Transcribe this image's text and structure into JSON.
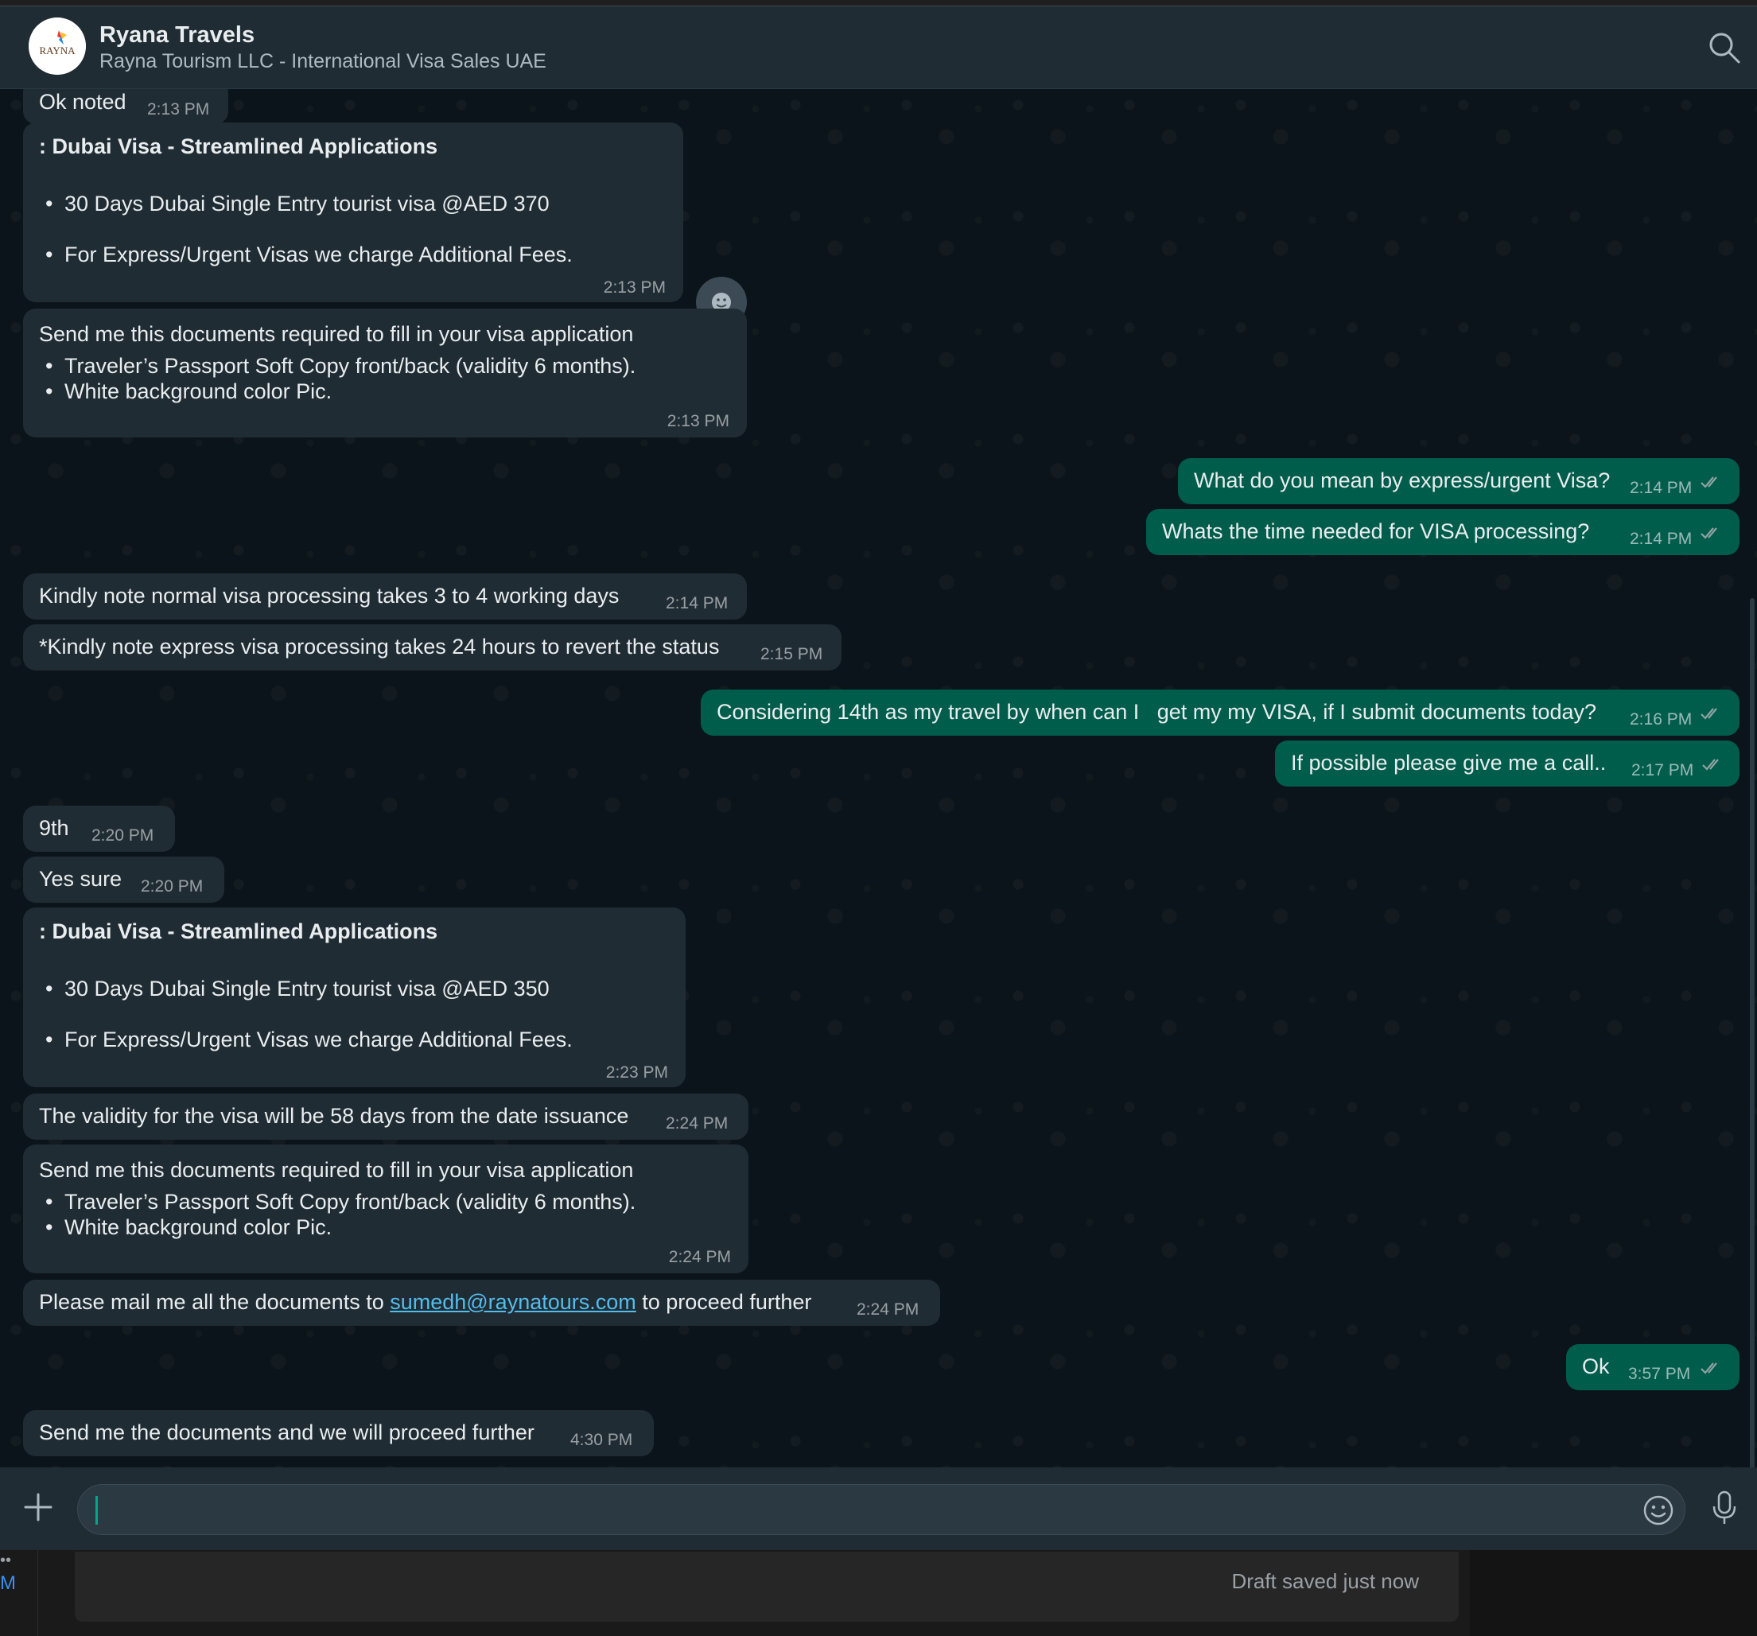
{
  "header": {
    "contact_name": "Ryana Travels",
    "contact_subtitle": "Rayna Tourism LLC - International Visa Sales UAE",
    "avatar_text": "RAYNA"
  },
  "messages": [
    {
      "id": "m0",
      "dir": "in",
      "text": "Ok noted",
      "time": "2:13 PM"
    },
    {
      "id": "m1",
      "dir": "in",
      "title": ": Dubai Visa - Streamlined Applications",
      "bullets": [
        "30 Days Dubai Single Entry tourist visa @AED 370",
        "For Express/Urgent Visas we charge Additional Fees."
      ],
      "time": "2:13 PM"
    },
    {
      "id": "m2",
      "dir": "in",
      "text": "Send me this documents required to fill in your visa application",
      "bullets": [
        "Traveler’s Passport Soft Copy front/back (validity 6 months).",
        "White background color Pic."
      ],
      "time": "2:13 PM"
    },
    {
      "id": "m3",
      "dir": "out",
      "text": "What do you mean by express/urgent Visa?",
      "time": "2:14 PM"
    },
    {
      "id": "m4",
      "dir": "out",
      "text": "Whats the time needed for VISA processing?",
      "time": "2:14 PM"
    },
    {
      "id": "m5",
      "dir": "in",
      "text": "Kindly note normal visa processing takes 3 to 4 working days",
      "time": "2:14 PM"
    },
    {
      "id": "m6",
      "dir": "in",
      "text": "*Kindly note express visa processing takes 24 hours to revert the status",
      "time": "2:15 PM"
    },
    {
      "id": "m7",
      "dir": "out",
      "text": "Considering 14th as my travel by when can I   get my my VISA, if I submit documents today?",
      "time": "2:16 PM"
    },
    {
      "id": "m8",
      "dir": "out",
      "text": "If possible please give me a call..",
      "time": "2:17 PM"
    },
    {
      "id": "m9",
      "dir": "in",
      "text": "9th",
      "time": "2:20 PM"
    },
    {
      "id": "m10",
      "dir": "in",
      "text": "Yes sure",
      "time": "2:20 PM"
    },
    {
      "id": "m11",
      "dir": "in",
      "title": ": Dubai Visa - Streamlined Applications",
      "bullets": [
        "30 Days Dubai Single Entry tourist visa @AED 350",
        "For Express/Urgent Visas we charge Additional Fees."
      ],
      "time": "2:23 PM"
    },
    {
      "id": "m12",
      "dir": "in",
      "text": "The validity for the visa will be 58 days from the date issuance",
      "time": "2:24 PM"
    },
    {
      "id": "m13",
      "dir": "in",
      "text": "Send me this documents required to fill in your visa application",
      "bullets": [
        "Traveler’s Passport Soft Copy front/back (validity 6 months).",
        "White background color Pic."
      ],
      "time": "2:24 PM"
    },
    {
      "id": "m14",
      "dir": "in",
      "text_before": "Please mail me all the documents to ",
      "link": "sumedh@raynatours.com",
      "text_after": " to proceed further",
      "time": "2:24 PM"
    },
    {
      "id": "m15",
      "dir": "out",
      "text": "Ok",
      "time": "3:57 PM"
    },
    {
      "id": "m16",
      "dir": "in",
      "text": "Send me the documents and we will proceed further",
      "time": "4:30 PM"
    }
  ],
  "composer": {
    "value": ""
  },
  "bottom": {
    "draft_status": "Draft saved just now",
    "left_dots": "••",
    "left_letter": "M"
  },
  "icons": {
    "search": "search-icon",
    "reaction": "smiley-icon",
    "attach": "plus-icon",
    "emoji": "emoji-icon",
    "mic": "microphone-icon",
    "read": "double-check-icon"
  },
  "colors": {
    "incoming_bubble": "#202c33",
    "outgoing_bubble": "#005c4b",
    "chat_bg": "#0b141a",
    "header_bg": "#202c33",
    "link": "#53bdeb",
    "caret": "#00a884"
  }
}
